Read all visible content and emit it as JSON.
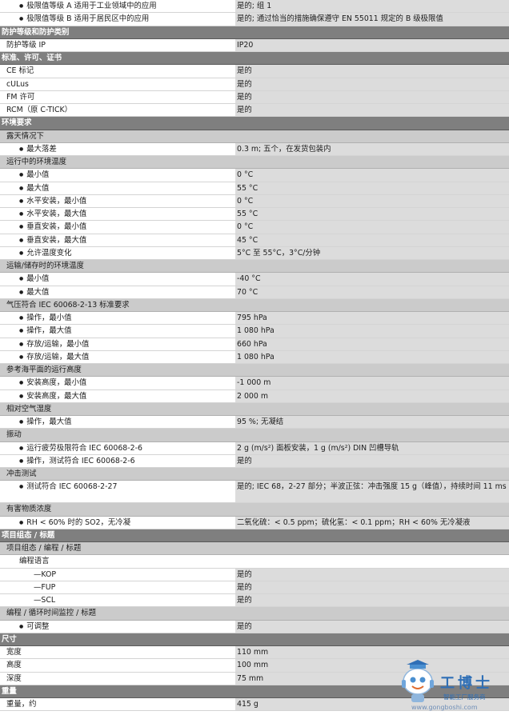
{
  "rows": [
    {
      "type": "item",
      "label": "极限值等级 A 适用于工业领域中的应用",
      "value": "是的; 组 1"
    },
    {
      "type": "item",
      "label": "极限值等级 B 适用于居民区中的应用",
      "value": "是的; 通过恰当的措施确保遵守 EN 55011 规定的 B 级极限值"
    },
    {
      "type": "sec",
      "label": "防护等级和防护类别",
      "value": ""
    },
    {
      "type": "plain",
      "label": "防护等级 IP",
      "value": "IP20"
    },
    {
      "type": "sec",
      "label": "标准、许可、证书",
      "value": ""
    },
    {
      "type": "plain",
      "label": "CE 标记",
      "value": "是的"
    },
    {
      "type": "plain",
      "label": "cULus",
      "value": "是的"
    },
    {
      "type": "plain",
      "label": "FM 许可",
      "value": "是的"
    },
    {
      "type": "plain",
      "label": "RCM（原 C-TICK）",
      "value": "是的"
    },
    {
      "type": "sec",
      "label": "环境要求",
      "value": ""
    },
    {
      "type": "sub",
      "label": "露天情况下",
      "value": ""
    },
    {
      "type": "item",
      "label": "最大落差",
      "value": "0.3 m; 五个，在发货包装内"
    },
    {
      "type": "sub",
      "label": "运行中的环境温度",
      "value": ""
    },
    {
      "type": "item",
      "label": "最小值",
      "value": "0 °C"
    },
    {
      "type": "item",
      "label": "最大值",
      "value": "55 °C"
    },
    {
      "type": "item",
      "label": "水平安装，最小值",
      "value": "0 °C"
    },
    {
      "type": "item",
      "label": "水平安装，最大值",
      "value": "55 °C"
    },
    {
      "type": "item",
      "label": "垂直安装，最小值",
      "value": "0 °C"
    },
    {
      "type": "item",
      "label": "垂直安装，最大值",
      "value": "45 °C"
    },
    {
      "type": "item",
      "label": "允许温度变化",
      "value": "5°C 至 55°C，3°C/分钟"
    },
    {
      "type": "sub",
      "label": "运输/储存时的环境温度",
      "value": ""
    },
    {
      "type": "item",
      "label": "最小值",
      "value": "-40 °C"
    },
    {
      "type": "item",
      "label": "最大值",
      "value": "70 °C"
    },
    {
      "type": "sub",
      "label": "气压符合 IEC 60068-2-13 标准要求",
      "value": ""
    },
    {
      "type": "item",
      "label": "操作，最小值",
      "value": "795 hPa"
    },
    {
      "type": "item",
      "label": "操作，最大值",
      "value": "1 080 hPa"
    },
    {
      "type": "item",
      "label": "存放/运输，最小值",
      "value": "660 hPa"
    },
    {
      "type": "item",
      "label": "存放/运输，最大值",
      "value": "1 080 hPa"
    },
    {
      "type": "sub",
      "label": "参考海平面的运行高度",
      "value": ""
    },
    {
      "type": "item",
      "label": "安装高度，最小值",
      "value": "-1 000 m"
    },
    {
      "type": "item",
      "label": "安装高度，最大值",
      "value": "2 000 m"
    },
    {
      "type": "sub",
      "label": "相对空气湿度",
      "value": ""
    },
    {
      "type": "item",
      "label": "操作，最大值",
      "value": "95 %; 无凝结"
    },
    {
      "type": "sub",
      "label": "振动",
      "value": ""
    },
    {
      "type": "item",
      "label": "运行疲劳极限符合 IEC 60068-2-6",
      "value": "2 g (m/s²) 面板安装，1 g (m/s²) DIN 凹槽导轨"
    },
    {
      "type": "item",
      "label": "操作，测试符合 IEC 60068-2-6",
      "value": "是的"
    },
    {
      "type": "sub",
      "label": "冲击测试",
      "value": ""
    },
    {
      "type": "item",
      "tall": true,
      "label": "测试符合 IEC 60068-2-27",
      "value": "是的; IEC 68，2-27 部分；半波正弦：冲击强度 15 g（峰值），持续时间 11 ms"
    },
    {
      "type": "sub",
      "label": "有害物质浓度",
      "value": ""
    },
    {
      "type": "item",
      "label": "RH < 60% 时的 SO2，无冷凝",
      "value": "二氧化硫：< 0.5 ppm；硫化氢：< 0.1 ppm；RH < 60% 无冷凝液"
    },
    {
      "type": "sec",
      "label": "项目组态 / 标题",
      "value": ""
    },
    {
      "type": "sub",
      "label": "项目组态 / 编程 / 标题",
      "value": ""
    },
    {
      "type": "sub2",
      "label": "编程语言",
      "value": ""
    },
    {
      "type": "dash",
      "label": "KOP",
      "value": "是的"
    },
    {
      "type": "dash",
      "label": "FUP",
      "value": "是的"
    },
    {
      "type": "dash",
      "label": "SCL",
      "value": "是的"
    },
    {
      "type": "sub",
      "label": "编程 / 循环时间监控 / 标题",
      "value": ""
    },
    {
      "type": "item",
      "label": "可调整",
      "value": "是的"
    },
    {
      "type": "sec",
      "label": "尺寸",
      "value": ""
    },
    {
      "type": "plain",
      "label": "宽度",
      "value": "110 mm"
    },
    {
      "type": "plain",
      "label": "高度",
      "value": "100 mm"
    },
    {
      "type": "plain",
      "label": "深度",
      "value": "75 mm"
    },
    {
      "type": "sec",
      "label": "重量",
      "value": ""
    },
    {
      "type": "plain",
      "label": "重量，约",
      "value": "415 g"
    }
  ],
  "watermark": {
    "brand": "工博士",
    "tagline": "智能工厂服务商",
    "url": "www.gongboshi.com"
  }
}
